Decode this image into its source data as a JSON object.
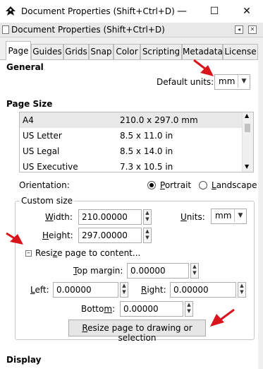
{
  "window": {
    "title": "Document Properties (Shift+Ctrl+D)",
    "minimize": "—",
    "maximize": "☐",
    "close": "✕"
  },
  "dock": {
    "title": "Document Properties (Shift+Ctrl+D)",
    "btn_left": "◂",
    "btn_close": "✕"
  },
  "tabs": [
    "Page",
    "Guides",
    "Grids",
    "Snap",
    "Color",
    "Scripting",
    "Metadata",
    "License"
  ],
  "general": {
    "heading": "General",
    "units_label": "Default units:",
    "units_value": "mm"
  },
  "page_size": {
    "heading": "Page Size",
    "rows": [
      {
        "name": "A4",
        "size": "210.0 x 297.0 mm"
      },
      {
        "name": "US Letter",
        "size": "8.5 x 11.0 in"
      },
      {
        "name": "US Legal",
        "size": "8.5 x 14.0 in"
      },
      {
        "name": "US Executive",
        "size": "7.3 x 10.5 in"
      }
    ]
  },
  "orientation": {
    "label": "Orientation:",
    "portrait": "Portrait",
    "landscape": "Landscape",
    "selected": "Portrait"
  },
  "custom_size": {
    "legend": "Custom size",
    "width_label": "Width:",
    "width_value": "210.00000",
    "height_label": "Height:",
    "height_value": "297.00000",
    "units_label": "Units:",
    "units_value": "mm"
  },
  "resize": {
    "expander_label": "Resize page to content...",
    "top_label": "Top margin:",
    "top_value": "0.00000",
    "left_label": "Left:",
    "left_value": "0.00000",
    "right_label": "Right:",
    "right_value": "0.00000",
    "bottom_label": "Bottom:",
    "bottom_value": "0.00000",
    "button_label": "Resize page to drawing or selection"
  },
  "display": {
    "heading": "Display"
  },
  "colors": {
    "annotation_arrow": "#d9141b",
    "selected_row": "#e8e8e8"
  }
}
